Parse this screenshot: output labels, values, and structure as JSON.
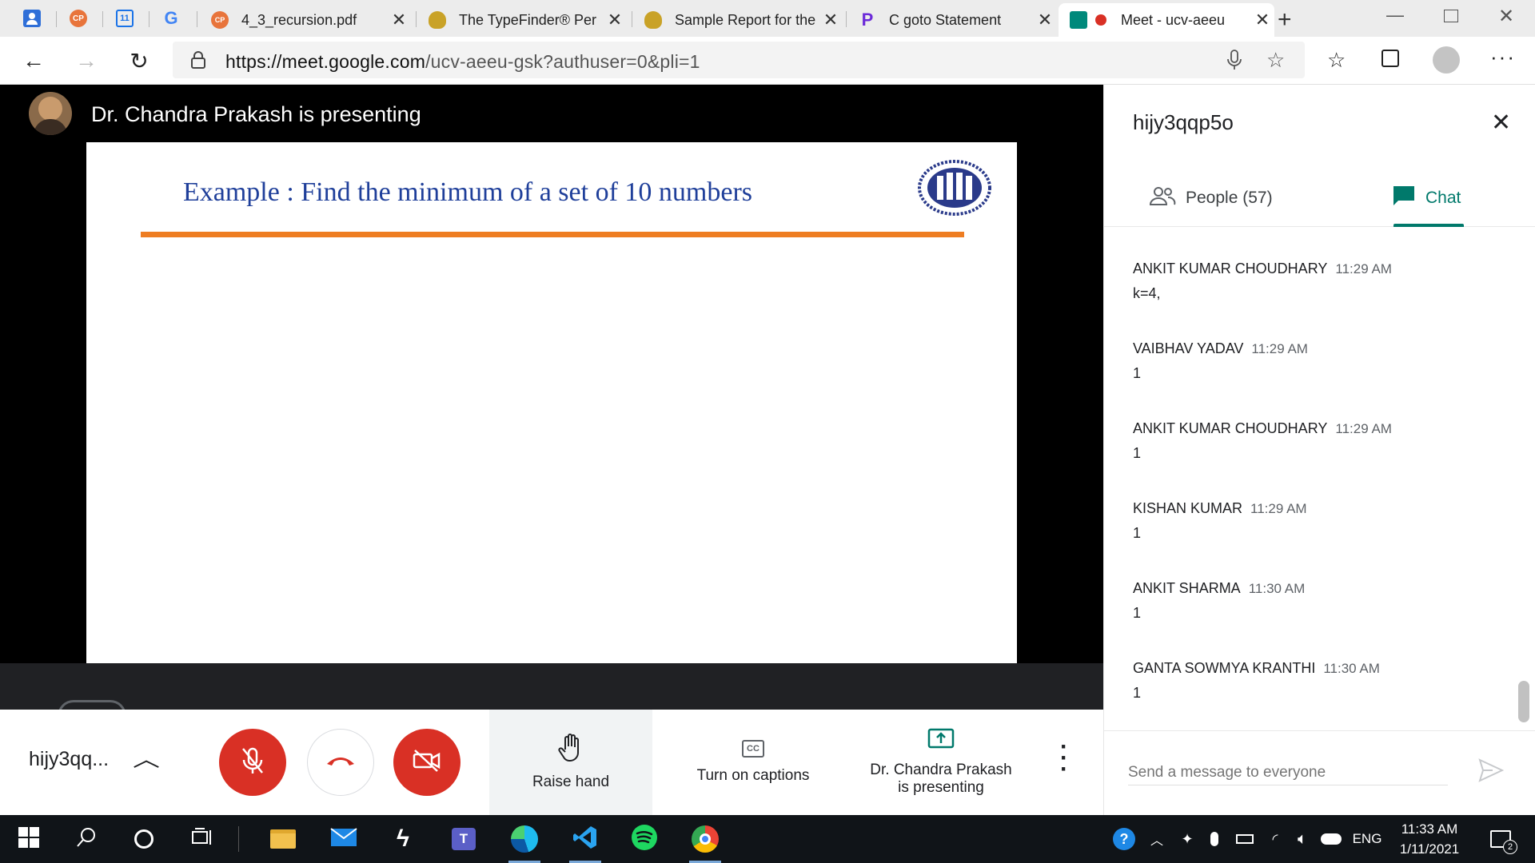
{
  "browser": {
    "pinned_tabs": [
      {
        "icon": "contacts-icon",
        "color": "#2f6fd8"
      },
      {
        "icon": "cp-icon",
        "color": "#e8743b",
        "text": "CP"
      },
      {
        "icon": "calendar-icon",
        "color": "#1a73e8",
        "text": "11"
      },
      {
        "icon": "google-icon",
        "color": "#4285f4",
        "text": "G"
      }
    ],
    "tabs": [
      {
        "label": "4_3_recursion.pdf",
        "icon_text": "CP",
        "icon_color": "#e8743b"
      },
      {
        "label": "The TypeFinder® Per",
        "icon_text": "",
        "icon_color": "#c9a227"
      },
      {
        "label": "Sample Report for the",
        "icon_text": "",
        "icon_color": "#c9a227"
      },
      {
        "label": "C goto Statement",
        "icon_text": "P",
        "icon_color": "#6c2bd9"
      },
      {
        "label": "Meet - ucv-aeeu",
        "icon_text": "",
        "icon_color": "#00897b"
      }
    ],
    "url_host": "https://meet.google.com",
    "url_path": "/ucv-aeeu-gsk?authuser=0&pli=1"
  },
  "meet": {
    "presenter_banner": "Dr. Chandra Prakash is presenting",
    "slide_title": "Example :  Find the minimum of a set of 10 numbers",
    "meeting_code_short": "hijy3qq...",
    "raise_hand_label": "Raise hand",
    "captions_label": "Turn on captions",
    "presenting_label_line1": "Dr. Chandra Prakash",
    "presenting_label_line2": "is presenting",
    "colors": {
      "red": "#d93025",
      "teal": "#00796b",
      "accent_orange": "#ee7d22",
      "slide_blue": "#1f3f9a"
    }
  },
  "panel": {
    "title": "hijy3qqp5o",
    "people_label": "People (57)",
    "chat_label": "Chat",
    "messages": [
      {
        "sender": "ANKIT KUMAR CHOUDHARY",
        "time": "11:29 AM",
        "text": "k=4,"
      },
      {
        "sender": "VAIBHAV YADAV",
        "time": "11:29 AM",
        "text": "1"
      },
      {
        "sender": "ANKIT KUMAR CHOUDHARY",
        "time": "11:29 AM",
        "text": "1"
      },
      {
        "sender": "KISHAN KUMAR",
        "time": "11:29 AM",
        "text": "1"
      },
      {
        "sender": "ANKIT SHARMA",
        "time": "11:30 AM",
        "text": "1"
      },
      {
        "sender": "GANTA SOWMYA KRANTHI",
        "time": "11:30 AM",
        "text": "1"
      }
    ],
    "composer_placeholder": "Send a message to everyone"
  },
  "taskbar": {
    "language": "ENG",
    "time": "11:33 AM",
    "date": "1/11/2021",
    "notifications": "2"
  }
}
